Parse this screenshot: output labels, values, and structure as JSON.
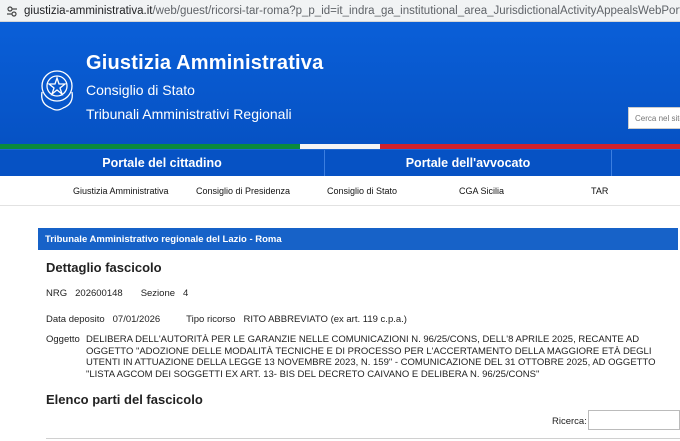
{
  "browser": {
    "url_host": "giustizia-amministrativa.it",
    "url_path": "/web/guest/ricorsi-tar-roma?p_p_id=it_indra_ga_institutional_area_JurisdictionalActivityAppealsWebPortlet_INSTANCE_U"
  },
  "header": {
    "title": "Giustizia Amministrativa",
    "subtitle1": "Consiglio di Stato",
    "subtitle2": "Tribunali Amministrativi Regionali",
    "search_placeholder": "Cerca nel sito"
  },
  "portal_nav": {
    "citizen": "Portale del cittadino",
    "lawyer": "Portale dell'avvocato"
  },
  "sub_nav": {
    "items": [
      "Giustizia Amministrativa",
      "Consiglio di Presidenza",
      "Consiglio di Stato",
      "CGA Sicilia",
      "TAR"
    ]
  },
  "section_band": "Tribunale Amministrativo regionale del Lazio - Roma",
  "dettaglio": {
    "heading": "Dettaglio fascicolo",
    "nrg_label": "NRG",
    "nrg_value": "202600148",
    "sezione_label": "Sezione",
    "sezione_value": "4",
    "deposito_label": "Data deposito",
    "deposito_value": "07/01/2026",
    "tipo_label": "Tipo ricorso",
    "tipo_value": "RITO ABBREVIATO (ex art. 119 c.p.a.)",
    "oggetto_label": "Oggetto",
    "oggetto_value": "DELIBERA DELL'AUTORITÀ PER LE GARANZIE NELLE COMUNICAZIONI N. 96/25/CONS, DELL'8 APRILE 2025, RECANTE AD OGGETTO \"ADOZIONE DELLE MODALITÀ TECNICHE E DI PROCESSO PER L'ACCERTAMENTO DELLA MAGGIORE ETÀ DEGLI UTENTI IN ATTUAZIONE DELLA LEGGE 13 NOVEMBRE 2023, N. 159\" - COMUNICAZIONE DEL 31 OTTOBRE 2025, AD OGGETTO \"LISTA AGCOM DEI SOGGETTI EX ART. 13- BIS DEL DECRETO CAIVANO E DELIBERA N. 96/25/CONS\""
  },
  "elenco": {
    "heading": "Elenco parti del fascicolo",
    "search_label": "Ricerca:"
  },
  "colors": {
    "header_blue": "#0652c4",
    "band_blue": "#1762c8",
    "flag_green": "#0a8a3e",
    "flag_red": "#d0222b"
  }
}
